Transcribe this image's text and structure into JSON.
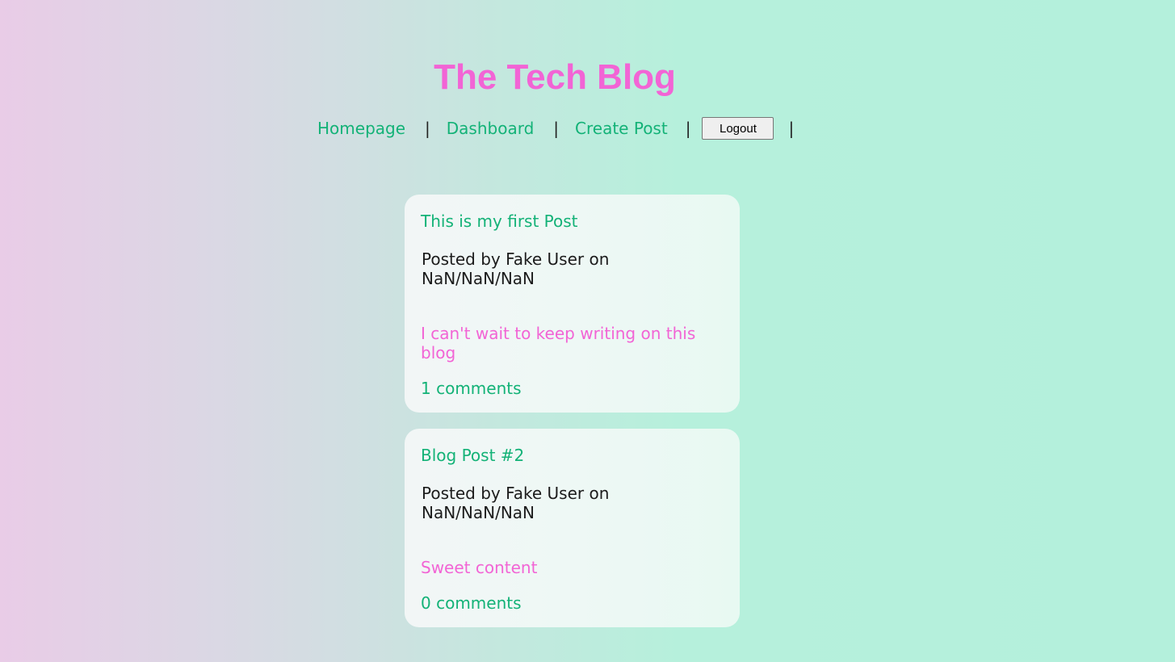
{
  "site": {
    "title": "The Tech Blog"
  },
  "nav": {
    "homepage": "Homepage",
    "dashboard": "Dashboard",
    "create_post": "Create Post",
    "logout": "Logout",
    "separator": "|"
  },
  "posts": [
    {
      "title": "This is my first Post",
      "meta": "Posted by Fake User on NaN/NaN/NaN",
      "body": "I can't wait to keep writing on this blog",
      "comments": "1 comments"
    },
    {
      "title": "Blog Post #2",
      "meta": "Posted by Fake User on NaN/NaN/NaN",
      "body": "Sweet content",
      "comments": "0 comments"
    }
  ],
  "colors": {
    "accent_pink": "#f264d5",
    "accent_green": "#13b277",
    "text_dark": "#1c1c1c"
  }
}
